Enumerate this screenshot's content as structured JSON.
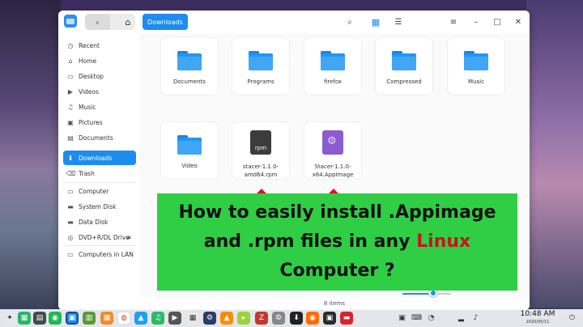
{
  "titlebar": {
    "breadcrumb": "Downloads",
    "back": "‹",
    "forward": "›",
    "home": "⌂",
    "search": "⌕",
    "grid_view": "▦",
    "list_view": "☰",
    "menu": "≡",
    "minimize": "–",
    "maximize": "□",
    "close": "✕"
  },
  "sidebar": {
    "items": [
      {
        "label": "Recent",
        "icon": "clock-icon",
        "glyph": "◷"
      },
      {
        "label": "Home",
        "icon": "home-icon",
        "glyph": "⌂"
      },
      {
        "label": "Desktop",
        "icon": "desktop-icon",
        "glyph": "▭"
      },
      {
        "label": "Videos",
        "icon": "video-icon",
        "glyph": "▶"
      },
      {
        "label": "Music",
        "icon": "music-icon",
        "glyph": "♫"
      },
      {
        "label": "Pictures",
        "icon": "picture-icon",
        "glyph": "▣"
      },
      {
        "label": "Documents",
        "icon": "document-icon",
        "glyph": "▤"
      },
      {
        "label": "Downloads",
        "icon": "download-icon",
        "glyph": "⬇"
      },
      {
        "label": "Trash",
        "icon": "trash-icon",
        "glyph": "🗑"
      },
      {
        "label": "Computer",
        "icon": "computer-icon",
        "glyph": "▭"
      },
      {
        "label": "System Disk",
        "icon": "disk-icon",
        "glyph": "▬"
      },
      {
        "label": "Data Disk",
        "icon": "disk-icon",
        "glyph": "▬"
      },
      {
        "label": "DVD+R/DL Drive",
        "icon": "dvd-icon",
        "glyph": "◎"
      },
      {
        "label": "Computers in LAN",
        "icon": "network-icon",
        "glyph": "▭"
      }
    ],
    "eject": "⏏",
    "active_index": 7
  },
  "files": [
    {
      "name": "Documents",
      "type": "folder"
    },
    {
      "name": "Programs",
      "type": "folder"
    },
    {
      "name": "firefox",
      "type": "folder"
    },
    {
      "name": "Compressed",
      "type": "folder"
    },
    {
      "name": "Music",
      "type": "folder"
    },
    {
      "name": "Video",
      "type": "folder"
    },
    {
      "name": "stacer-1.1.0-amd64.rpm",
      "line1": "stacer-1.1.0-",
      "line2": "amd64.rpm",
      "type": "rpm",
      "icon_text": "rpm"
    },
    {
      "name": "Stacer-1.1.0-x64.AppImage",
      "line1": "Stacer-1.1.0-",
      "line2": "x64.AppImage",
      "type": "appimage"
    }
  ],
  "banner": {
    "line1": "How to easily install .Appimage",
    "line2a": "and .rpm files in any ",
    "line2b": "Linux",
    "line3": "Computer ?"
  },
  "status": {
    "count": "8 items",
    "zoom_fraction": 0.55
  },
  "taskbar": {
    "time": "10:48 AM",
    "date": "2020/05/11",
    "tray": [
      "▣",
      "⌨",
      "◔",
      "▂",
      "♪",
      "⏻"
    ]
  },
  "colors": {
    "accent": "#1d8cf0",
    "banner_bg": "#2fce44",
    "banner_red": "#c8141c",
    "arrow": "#e8101a"
  }
}
